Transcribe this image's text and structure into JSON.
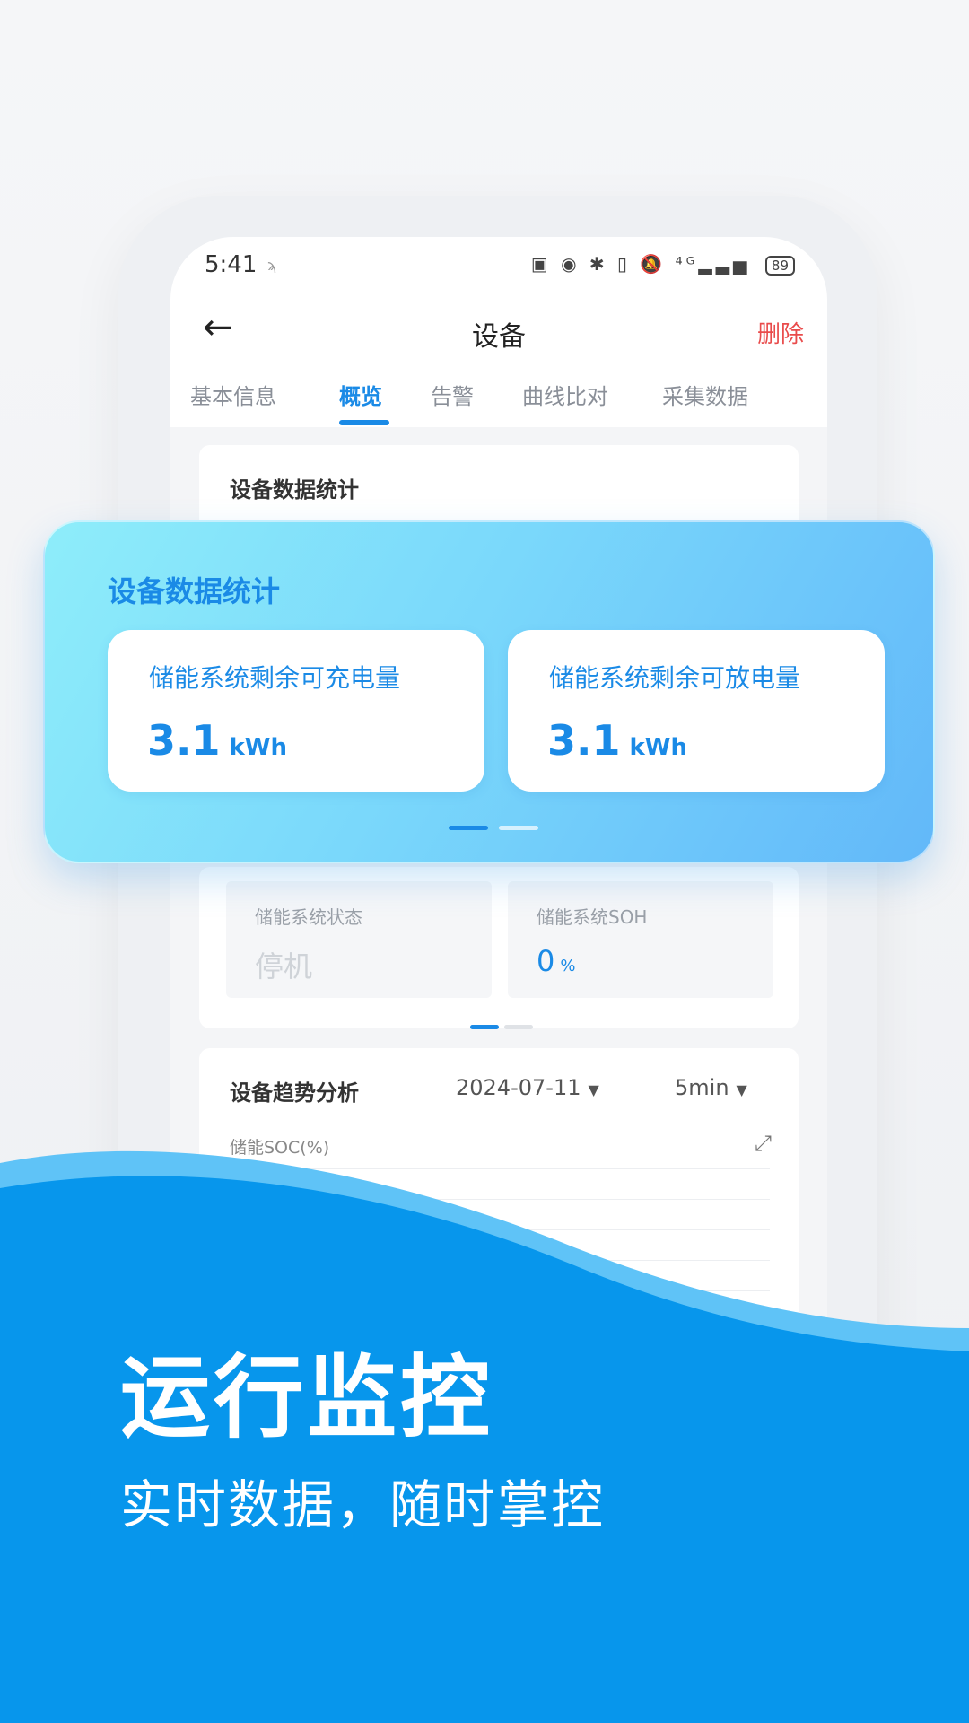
{
  "status_bar": {
    "time": "5:41",
    "notify_glyph": "ϡ",
    "icons": "▣ ◉ ✱ ▯ 🔕 ⁴ᴳ▂▃▅",
    "battery": "89"
  },
  "nav": {
    "back_glyph": "←",
    "title": "设备",
    "delete_label": "删除"
  },
  "tabs": [
    "基本信息",
    "概览",
    "告警",
    "曲线比对",
    "采集数据"
  ],
  "stats_card": {
    "title": "设备数据统计",
    "items": [
      {
        "label": "储能系统状态",
        "value": "停机",
        "unit": ""
      },
      {
        "label": "储能系统SOH",
        "value": "0",
        "unit": "%"
      }
    ]
  },
  "trend_card": {
    "title": "设备趋势分析",
    "date": "2024-07-11",
    "interval": "5min",
    "caret": "▼",
    "chart_label": "储能SOC(%)",
    "expand_glyph": "⤢"
  },
  "highlight": {
    "title": "设备数据统计",
    "items": [
      {
        "label": "储能系统剩余可充电量",
        "value": "3.1",
        "unit": "kWh"
      },
      {
        "label": "储能系统剩余可放电量",
        "value": "3.1",
        "unit": "kWh"
      }
    ]
  },
  "hero": {
    "title": "运行监控",
    "subtitle": "实时数据，随时掌控"
  },
  "colors": {
    "accent": "#1a8ae6",
    "wave": "#0796ec",
    "danger": "#e94b4b"
  }
}
